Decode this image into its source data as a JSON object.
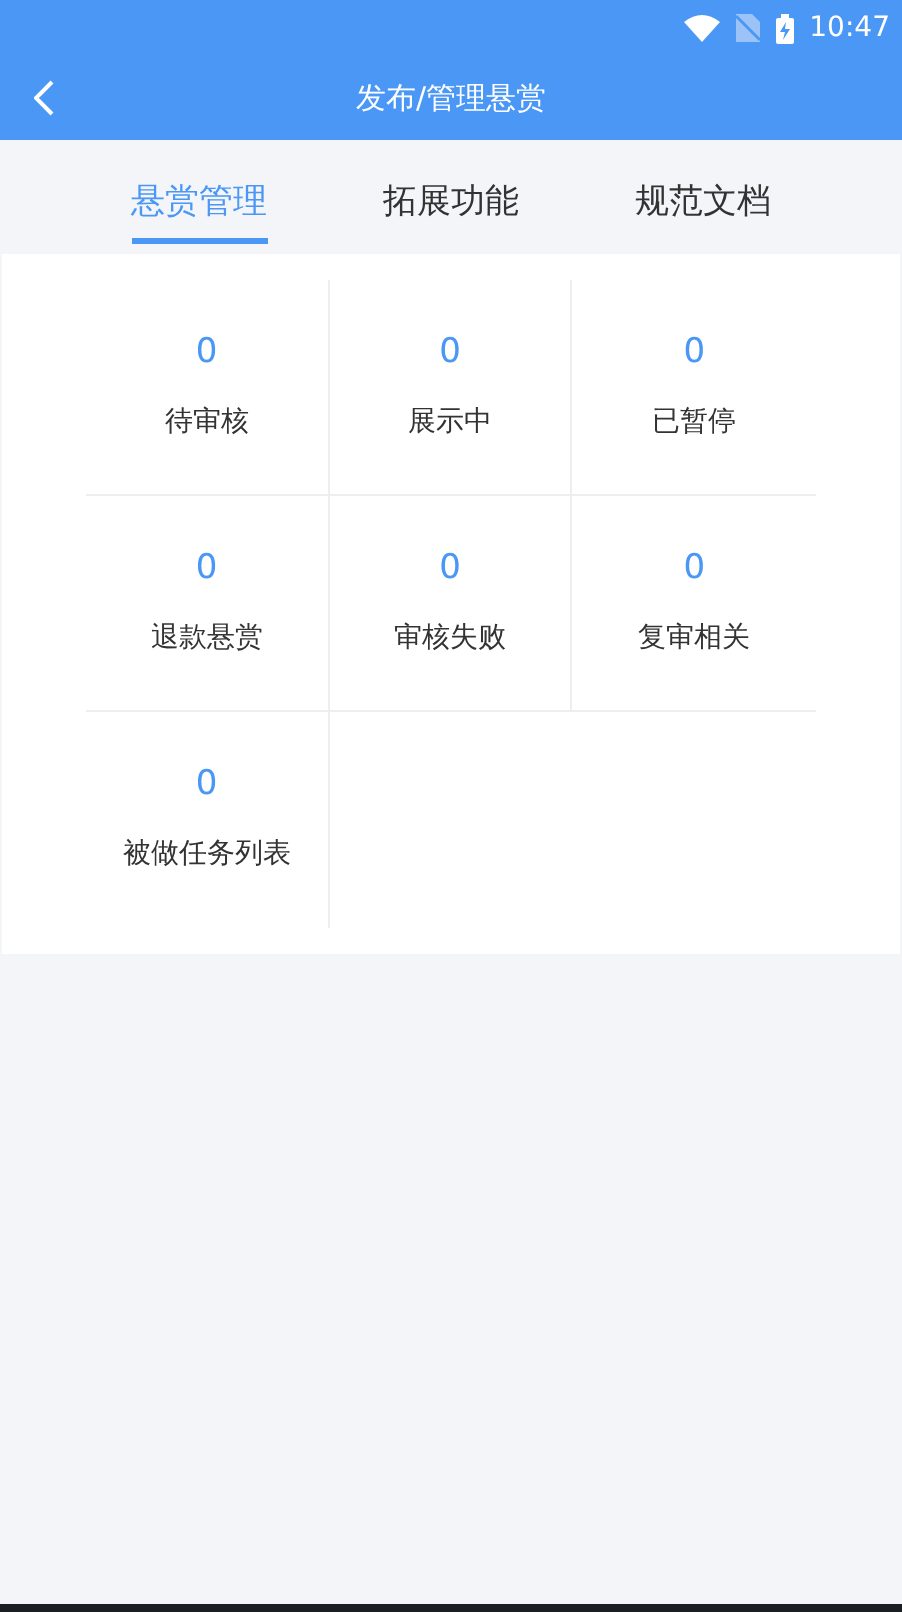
{
  "status_bar": {
    "time": "10:47"
  },
  "header": {
    "title": "发布/管理悬赏"
  },
  "tabs": [
    {
      "label": "悬赏管理",
      "selected": true
    },
    {
      "label": "拓展功能",
      "selected": false
    },
    {
      "label": "规范文档",
      "selected": false
    }
  ],
  "stats": [
    {
      "count": "0",
      "label": "待审核"
    },
    {
      "count": "0",
      "label": "展示中"
    },
    {
      "count": "0",
      "label": "已暂停"
    },
    {
      "count": "0",
      "label": "退款悬赏"
    },
    {
      "count": "0",
      "label": "审核失败"
    },
    {
      "count": "0",
      "label": "复审相关"
    },
    {
      "count": "0",
      "label": "被做任务列表"
    }
  ]
}
